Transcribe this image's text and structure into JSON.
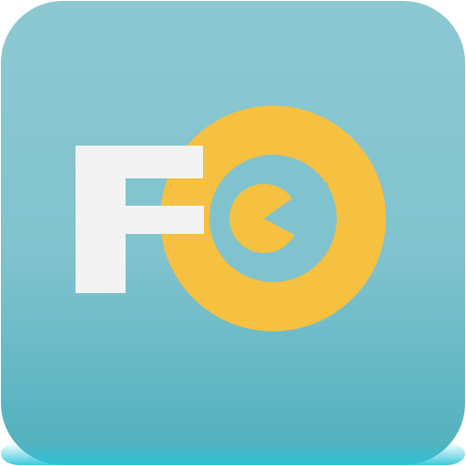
{
  "app_icon": {
    "kind": "app-icon",
    "logo_text": "FC",
    "colors": {
      "background_top": "#8DC8D2",
      "background_middle": "#80C3CE",
      "background_bottom": "#4FAFBC",
      "edge_highlight": "#2BC3D8",
      "letter_f": "#F3F3F3",
      "ring": "#F6C040"
    }
  }
}
